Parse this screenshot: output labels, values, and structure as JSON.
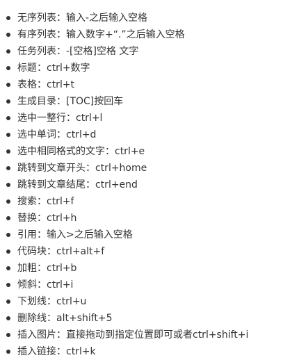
{
  "items": [
    {
      "label": "无序列表：输入-之后输入空格"
    },
    {
      "label": "有序列表：输入数字+“.”之后输入空格"
    },
    {
      "label": "任务列表：-[空格]空格 文字"
    },
    {
      "label": "标题：ctrl+数字"
    },
    {
      "label": "表格：ctrl+t"
    },
    {
      "label": "生成目录：[TOC]按回车"
    },
    {
      "label": "选中一整行：ctrl+l"
    },
    {
      "label": "选中单词：ctrl+d"
    },
    {
      "label": "选中相同格式的文字：ctrl+e"
    },
    {
      "label": "跳转到文章开头：ctrl+home"
    },
    {
      "label": "跳转到文章结尾：ctrl+end"
    },
    {
      "label": "搜索：ctrl+f"
    },
    {
      "label": "替换：ctrl+h"
    },
    {
      "label": "引用：输入>之后输入空格"
    },
    {
      "label": "代码块：ctrl+alt+f"
    },
    {
      "label": "加粗：ctrl+b"
    },
    {
      "label": "倾斜：ctrl+i"
    },
    {
      "label": "下划线：ctrl+u"
    },
    {
      "label": "删除线：alt+shift+5"
    },
    {
      "label": "插入图片：直接拖动到指定位置即可或者ctrl+shift+i"
    },
    {
      "label": "插入链接：ctrl+k"
    }
  ]
}
